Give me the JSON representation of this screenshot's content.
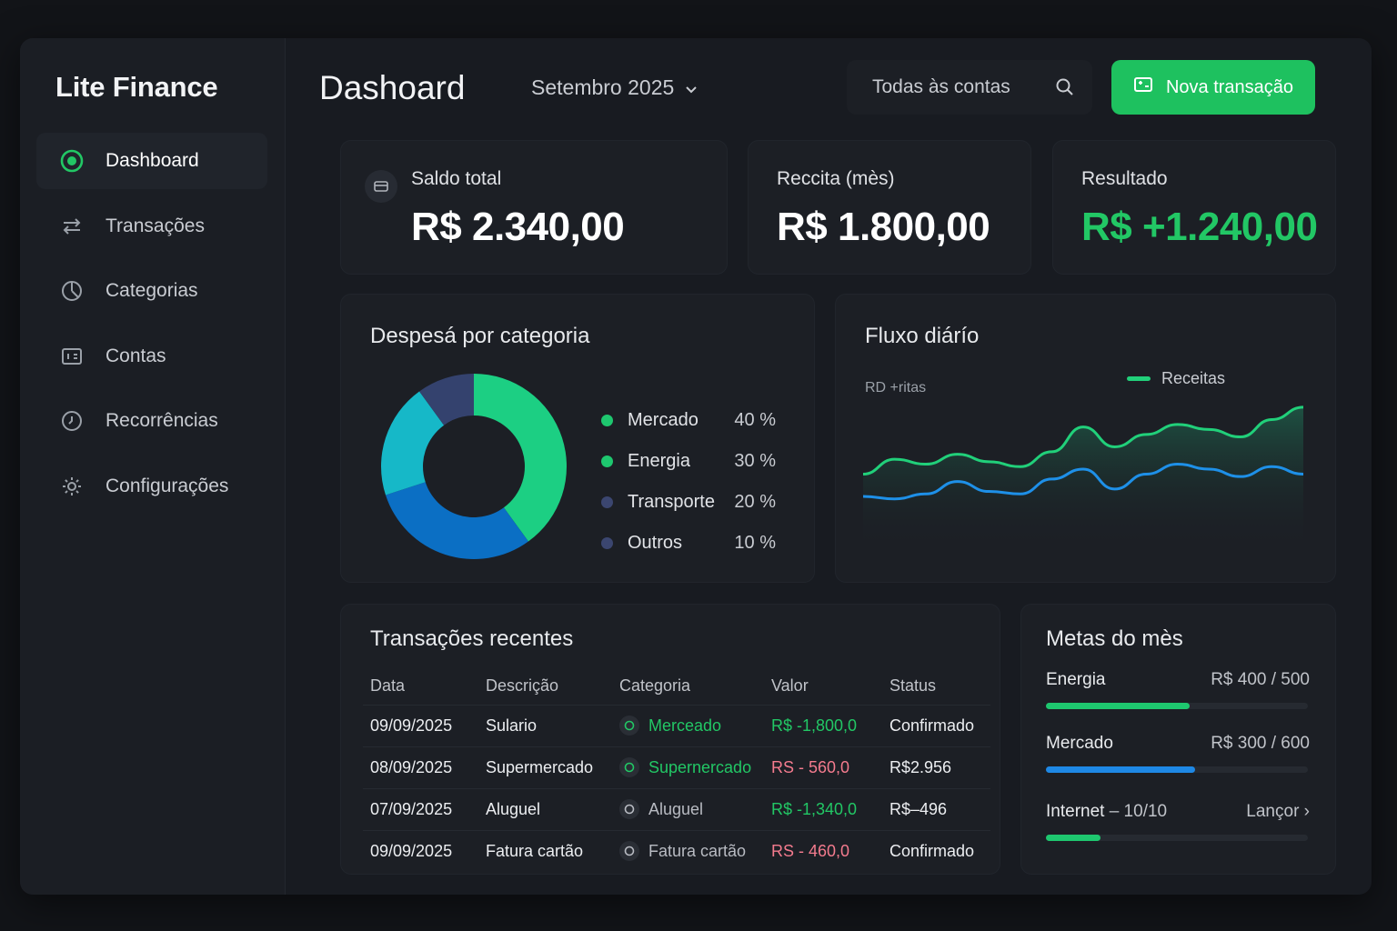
{
  "sidebar": {
    "brand": "Lite Finance",
    "items": [
      {
        "label": "Dashboard",
        "icon": "target-icon"
      },
      {
        "label": "Transações",
        "icon": "transfer-arrows-icon"
      },
      {
        "label": "Categorias",
        "icon": "pie-chart-icon"
      },
      {
        "label": "Contas",
        "icon": "wallet-icon"
      },
      {
        "label": "Recorrências",
        "icon": "recurring-icon"
      },
      {
        "label": "Configurações",
        "icon": "gear-icon"
      }
    ]
  },
  "header": {
    "title": "Dashoard",
    "month": "Setembro 2025",
    "accounts_filter": "Todas às contas",
    "new_button": "Nova transação"
  },
  "stats": {
    "saldo": {
      "label": "Saldo total",
      "value": "R$ 2.340,00"
    },
    "receita": {
      "label": "Reccita (mès)",
      "value": "R$ 1.800,00"
    },
    "resultado": {
      "label": "Resultado",
      "value": "R$ +1.240,00"
    }
  },
  "expenses": {
    "title": "Despesá por categoria",
    "chart_data": {
      "type": "pie",
      "categories": [
        "Mercado",
        "Energia",
        "Transporte",
        "Outros"
      ],
      "values": [
        40,
        30,
        20,
        10
      ],
      "labels": [
        "40 %",
        "30 %",
        "20 %",
        "10 %"
      ],
      "legend_colors": [
        "#1ec76f",
        "#1ec76f",
        "#3b4670",
        "#3b4670"
      ]
    }
  },
  "flow": {
    "title": "Fluxo diárío",
    "y_label": "RD +ritas",
    "legend": "Receitas",
    "chart_data": {
      "type": "area",
      "series": [
        {
          "name": "Receitas",
          "color": "#21d07a",
          "values": [
            40,
            52,
            48,
            56,
            50,
            46,
            58,
            78,
            62,
            72,
            80,
            76,
            70,
            84,
            94
          ]
        },
        {
          "color": "#1e90e8",
          "values": [
            22,
            20,
            24,
            34,
            26,
            24,
            36,
            44,
            28,
            40,
            48,
            44,
            38,
            46,
            40
          ]
        }
      ],
      "ylim": [
        0,
        110
      ]
    }
  },
  "transactions": {
    "title": "Transações recentes",
    "columns": [
      "Data",
      "Descrição",
      "Categoria",
      "Valor",
      "Status"
    ],
    "rows": [
      {
        "date": "09/09/2025",
        "desc": "Sulario",
        "cat": "Merceado",
        "value": "R$ -1,800,0",
        "status": "Confirmado",
        "catColor": "#22c765",
        "valColor": "#22c765"
      },
      {
        "date": "08/09/2025",
        "desc": "Supermercado",
        "cat": "Supernercado",
        "value": "RS  - 560,0",
        "status": "R$2.956",
        "catColor": "#22c765",
        "valColor": "#f47b8e"
      },
      {
        "date": "07/09/2025",
        "desc": "Aluguel",
        "cat": "Aluguel",
        "value": "R$ -1,340,0",
        "status": "R$–496",
        "catColor": "#b8bbc2",
        "valColor": "#22c765"
      },
      {
        "date": "09/09/2025",
        "desc": "Fatura cartão",
        "cat": "Fatura cartão",
        "value": "RS  - 460,0",
        "status": "Confirmado",
        "catColor": "#b8bbc2",
        "valColor": "#f47b8e"
      }
    ]
  },
  "goals": {
    "title": "Metas do mès",
    "items": [
      {
        "name": "Energia",
        "amount": "R$ 400 / 500",
        "progress": 0.55,
        "color": "#1ec76f"
      },
      {
        "name": "Mercado",
        "amount": "R$ 300 / 600",
        "progress": 0.57,
        "color": "#1e88e5"
      },
      {
        "name": "Internet",
        "sub": " – 10/10",
        "amount": "Lançor ›",
        "progress": 0.21,
        "color": "#1ec76f"
      }
    ]
  }
}
